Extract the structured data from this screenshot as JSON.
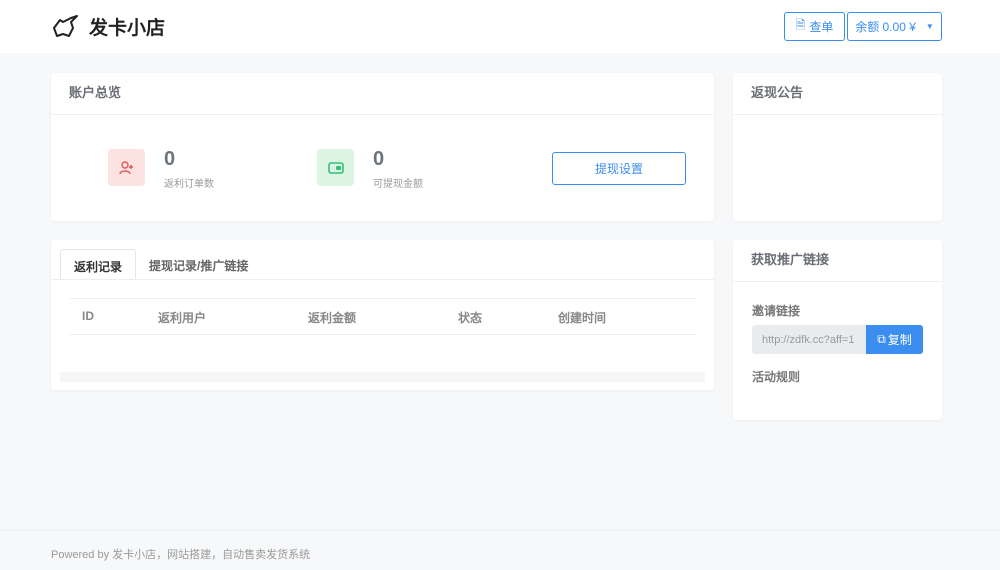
{
  "header": {
    "title": "发卡小店",
    "order_btn": "查单",
    "balance_btn": "余额 0.00 ¥"
  },
  "overview": {
    "title": "账户总览",
    "stats": [
      {
        "value": "0",
        "label": "返利订单数"
      },
      {
        "value": "0",
        "label": "可提现金额"
      }
    ],
    "withdraw_btn": "提现设置"
  },
  "notice": {
    "title": "返现公告"
  },
  "records": {
    "tabs": [
      "返利记录",
      "提现记录/推广链接"
    ],
    "columns": [
      "ID",
      "返利用户",
      "返利金额",
      "状态",
      "创建时间"
    ]
  },
  "promo": {
    "title": "获取推广链接",
    "invite_label": "邀请链接",
    "invite_value": "http://zdfk.cc?aff=1",
    "copy_btn": "复制",
    "rules_label": "活动规则"
  },
  "footer": {
    "text": "Powered by 发卡小店，网站搭建，自动售卖发货系统"
  }
}
